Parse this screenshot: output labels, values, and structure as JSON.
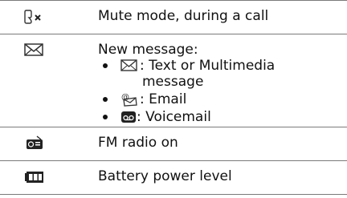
{
  "rows": [
    {
      "icon": "mute-icon",
      "label": "Mute mode, during a call"
    },
    {
      "icon": "envelope-icon",
      "label": "New message:",
      "items": [
        {
          "icon": "envelope-icon",
          "text": ": Text or Multimedia",
          "continuation": "message"
        },
        {
          "icon": "email-icon",
          "text": ": Email"
        },
        {
          "icon": "voicemail-icon",
          "text": " : Voicemail"
        }
      ]
    },
    {
      "icon": "fm-radio-icon",
      "label": "FM radio on"
    },
    {
      "icon": "battery-icon",
      "label": "Battery power level"
    }
  ],
  "colors": {
    "rule": "#7a7a7a",
    "text": "#111111"
  }
}
